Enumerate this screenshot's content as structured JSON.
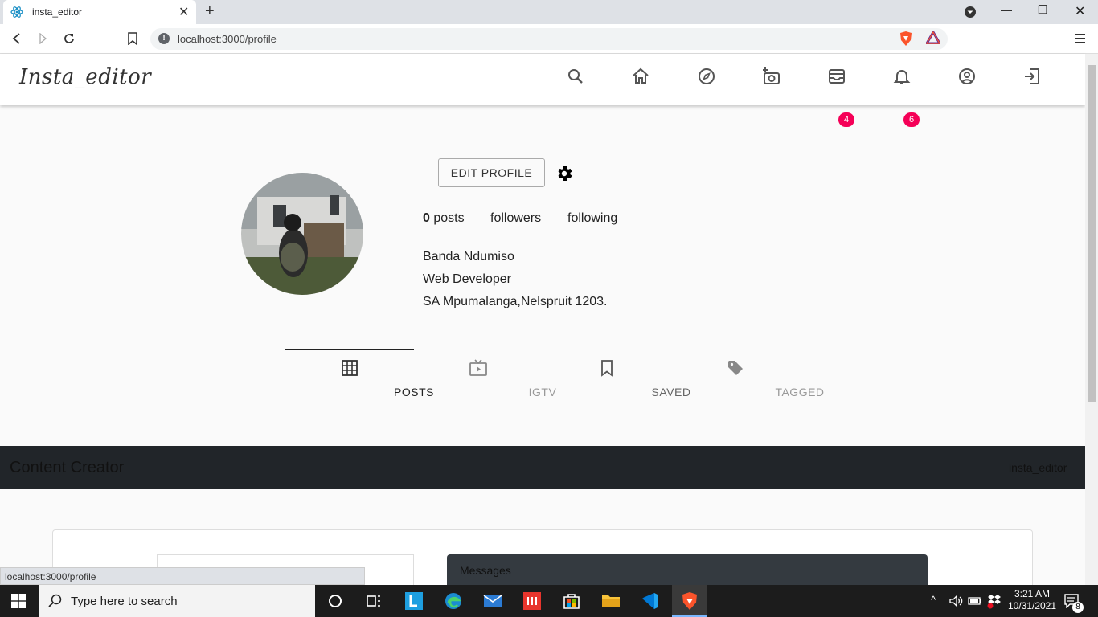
{
  "browser": {
    "tab_title": "insta_editor",
    "url": "localhost:3000/profile",
    "status_url": "localhost:3000/profile"
  },
  "app": {
    "logo": "Insta_editor",
    "nav_icons": [
      "search-icon",
      "home-icon",
      "explore-icon",
      "add-photo-icon",
      "inbox-icon",
      "notifications-icon",
      "account-icon",
      "logout-icon"
    ],
    "inbox_badge": "4",
    "notifications_badge": "6",
    "badge_color": "#f50057"
  },
  "profile": {
    "edit_button": "EDIT PROFILE",
    "posts_count": "0",
    "posts_label": "posts",
    "followers_label": "followers",
    "following_label": "following",
    "name": "Banda Ndumiso",
    "title": "Web Developer",
    "location": "SA Mpumalanga,Nelspruit 1203."
  },
  "tabs": [
    {
      "label": "POSTS",
      "icon": "grid-icon",
      "active": true
    },
    {
      "label": "IGTV",
      "icon": "tv-icon",
      "active": false
    },
    {
      "label": "SAVED",
      "icon": "bookmark-icon",
      "active": false
    },
    {
      "label": "TAGGED",
      "icon": "tag-icon",
      "active": false
    }
  ],
  "footer": {
    "brand": "Content Creator",
    "right_link": "insta_editor",
    "messages_title": "Messages"
  },
  "taskbar": {
    "search_placeholder": "Type here to search",
    "time": "3:21 AM",
    "date": "10/31/2021",
    "notif_count": "8"
  }
}
